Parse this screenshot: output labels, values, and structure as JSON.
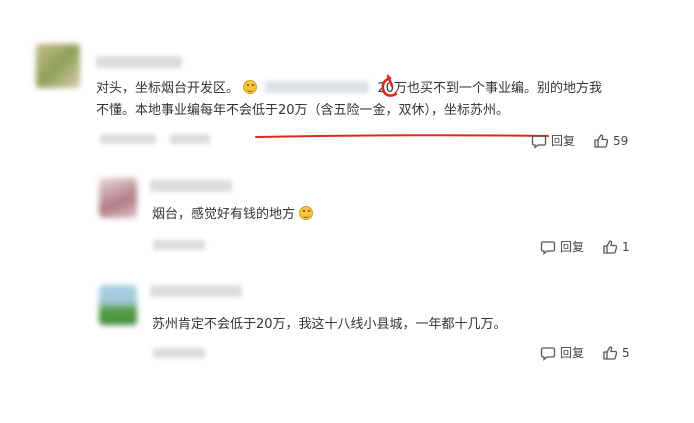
{
  "comments": [
    {
      "text_line1_a": "对头，坐标烟台开发区。",
      "text_line1_b": "20万也买不到一个事业编。别的地方我",
      "text_line2": "不懂。本地事业编每年不会低于20万（含五险一金，双休），坐标苏州。",
      "reply_label": "回复",
      "like_count": "59"
    },
    {
      "text": "烟台，感觉好有钱的地方",
      "reply_label": "回复",
      "like_count": "1"
    },
    {
      "text": "苏州肯定不会低于20万，我这十八线小县城，一年都十几万。",
      "reply_label": "回复",
      "like_count": "5"
    }
  ],
  "colors": {
    "annotation_red": "#e0271b",
    "text": "#333333",
    "placeholder_blur": "#d4d4d4"
  },
  "icons": [
    "smile-emoji-icon",
    "comment-icon",
    "thumbs-up-icon"
  ]
}
